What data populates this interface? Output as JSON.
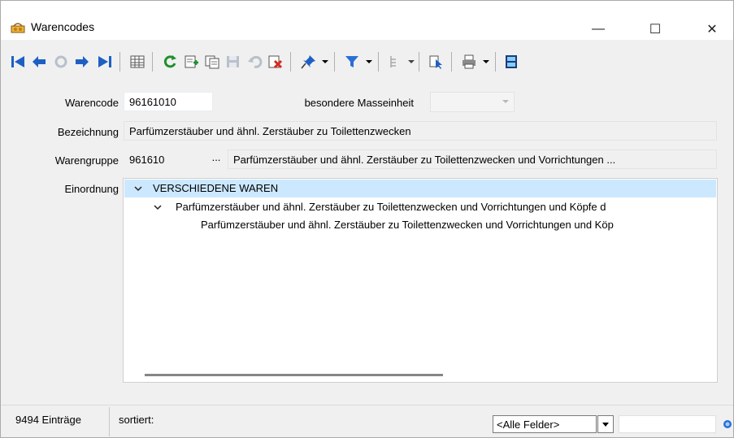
{
  "window": {
    "title": "Warencodes",
    "minimize_glyph": "—",
    "maximize_glyph": "☐",
    "close_glyph": "✕"
  },
  "toolbar": {
    "icons": [
      "first-record-icon",
      "previous-record-icon",
      "refresh-disabled-icon",
      "next-record-icon",
      "last-record-icon",
      "table-view-icon",
      "reload-icon",
      "new-record-icon",
      "copy-record-icon",
      "save-icon",
      "undo-icon",
      "delete-icon",
      "pin-icon",
      "filter-icon",
      "tree-icon",
      "cursor-select-icon",
      "print-icon",
      "layout-icon"
    ],
    "colors": {
      "blue": "#1e5fc4",
      "green": "#1e8f2e",
      "red": "#d62b1f",
      "gray": "#8a8a8a"
    }
  },
  "form": {
    "warencode_label": "Warencode",
    "warencode_value": "96161010",
    "masseinheit_label": "besondere Masseinheit",
    "masseinheit_value": "",
    "bezeichnung_label": "Bezeichnung",
    "bezeichnung_value": "Parfümzerstäuber und ähnl. Zerstäuber zu Toilettenzwecken",
    "warengruppe_label": "Warengruppe",
    "warengruppe_code": "961610",
    "warengruppe_button": "...",
    "warengruppe_text": "Parfümzerstäuber und ähnl. Zerstäuber zu Toilettenzwecken und Vorrichtungen ...",
    "einordnung_label": "Einordnung"
  },
  "tree": {
    "items": [
      {
        "text": "VERSCHIEDENE WAREN"
      },
      {
        "text": "Parfümzerstäuber und ähnl. Zerstäuber zu Toilettenzwecken und Vorrichtungen und Köpfe d"
      },
      {
        "text": "Parfümzerstäuber und ähnl. Zerstäuber zu Toilettenzwecken und Vorrichtungen und Köp"
      }
    ]
  },
  "statusbar": {
    "count": "9494 Einträge",
    "sorted": "sortiert:",
    "filter_value": "<Alle Felder>",
    "search_value": ""
  }
}
